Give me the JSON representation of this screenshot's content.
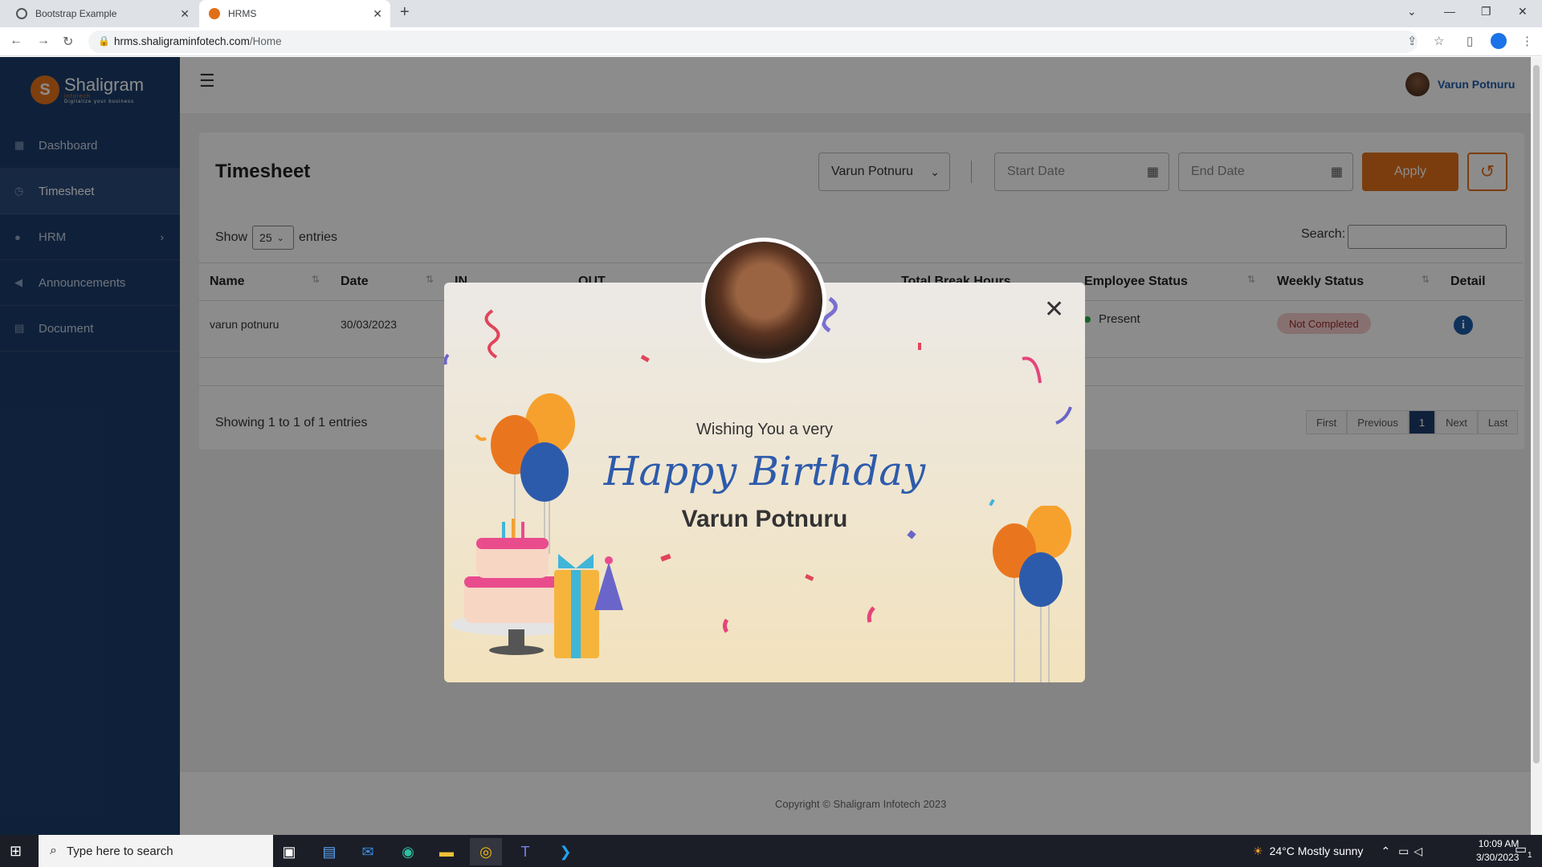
{
  "browser": {
    "tabs": [
      {
        "title": "Bootstrap Example",
        "active": false
      },
      {
        "title": "HRMS",
        "active": true
      }
    ],
    "url_host": "hrms.shaligraminfotech.com",
    "url_path": "/Home"
  },
  "sidebar": {
    "logo_text": "Shaligram",
    "logo_sub": "Infotech",
    "logo_tagline": "Digitalize your business",
    "items": [
      {
        "label": "Dashboard",
        "icon": "dashboard-icon"
      },
      {
        "label": "Timesheet",
        "icon": "clock-icon",
        "active": true
      },
      {
        "label": "HRM",
        "icon": "user-icon",
        "has_submenu": true
      },
      {
        "label": "Announcements",
        "icon": "megaphone-icon"
      },
      {
        "label": "Document",
        "icon": "document-icon"
      }
    ]
  },
  "header": {
    "user_name": "Varun Potnuru"
  },
  "timesheet": {
    "title": "Timesheet",
    "employee_select": "Varun Potnuru",
    "start_date_placeholder": "Start Date",
    "end_date_placeholder": "End Date",
    "apply_label": "Apply",
    "show_label": "Show",
    "entries_value": "25",
    "entries_label": "entries",
    "search_label": "Search:",
    "columns": [
      "Name",
      "Date",
      "IN",
      "OUT",
      "Total Break Hours",
      "Employee Status",
      "Weekly Status",
      "Detail"
    ],
    "rows": [
      {
        "name": "varun potnuru",
        "date": "30/03/2023",
        "employee_status": "Present",
        "weekly_status": "Not Completed"
      }
    ],
    "showing_text": "Showing 1 to 1 of 1 entries",
    "pagination": [
      "First",
      "Previous",
      "1",
      "Next",
      "Last"
    ],
    "current_page": "1"
  },
  "footer": {
    "copyright": "Copyright © Shaligram Infotech 2023"
  },
  "modal": {
    "wish_text": "Wishing You a very",
    "happy_birthday": "Happy Birthday",
    "name": "Varun Potnuru"
  },
  "taskbar": {
    "search_placeholder": "Type here to search",
    "weather": "24°C  Mostly sunny",
    "time": "10:09 AM",
    "date": "3/30/2023",
    "notification_count": "1"
  },
  "colors": {
    "sidebar": "#1d3d6b",
    "accent": "#e06f1a",
    "link": "#1d5ba6",
    "present": "#2bb24c"
  }
}
